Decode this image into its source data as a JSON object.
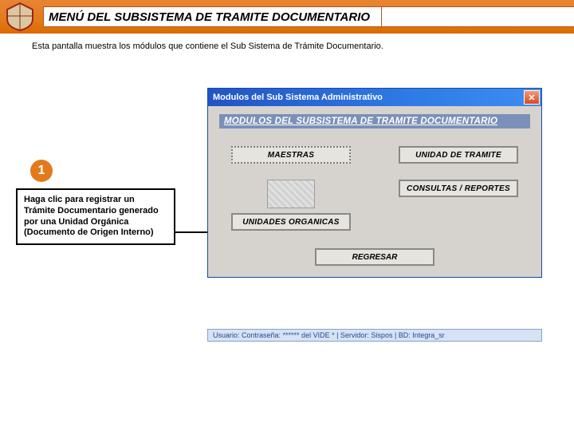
{
  "header": {
    "title": "MENÚ DEL SUBSISTEMA DE TRAMITE DOCUMENTARIO"
  },
  "intro": "Esta pantalla muestra los módulos que contiene el Sub Sistema de Trámite Documentario.",
  "callout": {
    "number": "1",
    "text": "Haga clic para registrar un Trámite Documentario generado por una Unidad Orgánica (Documento de Origen Interno)"
  },
  "window": {
    "title": "Modulos del Sub Sistema Administrativo",
    "banner": "MODULOS DEL SUBSISTEMA DE TRAMITE DOCUMENTARIO",
    "buttons": {
      "maestras": "MAESTRAS",
      "unidad": "UNIDAD DE TRAMITE",
      "unidades_org": "UNIDADES ORGANICAS",
      "consultas": "CONSULTAS / REPORTES",
      "regresar": "REGRESAR"
    },
    "status": "Usuario: Contraseña: ****** del VIDE * | Servidor: Sispos | BD: Integra_sr"
  }
}
